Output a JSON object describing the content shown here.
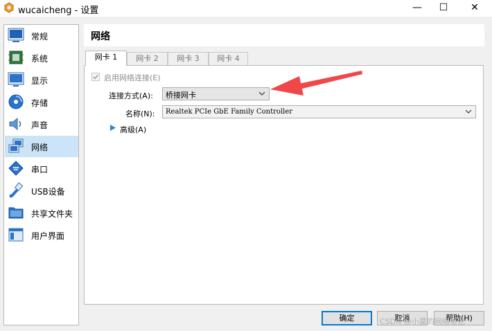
{
  "window": {
    "title": "wucaicheng - 设置",
    "controls": {
      "minimize": "—",
      "maximize": "☐",
      "close": "✕"
    }
  },
  "sidebar": {
    "items": [
      {
        "label": "常规",
        "icon": "general-icon"
      },
      {
        "label": "系统",
        "icon": "system-icon"
      },
      {
        "label": "显示",
        "icon": "display-icon"
      },
      {
        "label": "存储",
        "icon": "storage-icon"
      },
      {
        "label": "声音",
        "icon": "audio-icon"
      },
      {
        "label": "网络",
        "icon": "network-icon",
        "selected": true
      },
      {
        "label": "串口",
        "icon": "serial-port-icon"
      },
      {
        "label": "USB设备",
        "icon": "usb-icon"
      },
      {
        "label": "共享文件夹",
        "icon": "shared-folder-icon"
      },
      {
        "label": "用户界面",
        "icon": "user-interface-icon"
      }
    ]
  },
  "page": {
    "title": "网络"
  },
  "tabs": [
    {
      "label": "网卡 1",
      "active": true
    },
    {
      "label": "网卡 2"
    },
    {
      "label": "网卡 3"
    },
    {
      "label": "网卡 4"
    }
  ],
  "adapter": {
    "enable_label": "启用网络连接(E)",
    "enable_checked": true,
    "attached_label": "连接方式(A):",
    "attached_value": "桥接网卡",
    "name_label": "名称(N):",
    "name_value": "Realtek PCIe GbE Family Controller",
    "advanced_label": "高级(A)"
  },
  "buttons": {
    "ok": "确定",
    "cancel": "取消",
    "help": "帮助(H)"
  },
  "watermark": "CSDN @小莫的网络笔记",
  "colors": {
    "selection": "#cce4f7",
    "annotation_arrow": "#f0474a",
    "default_button_border": "#0078d7"
  }
}
